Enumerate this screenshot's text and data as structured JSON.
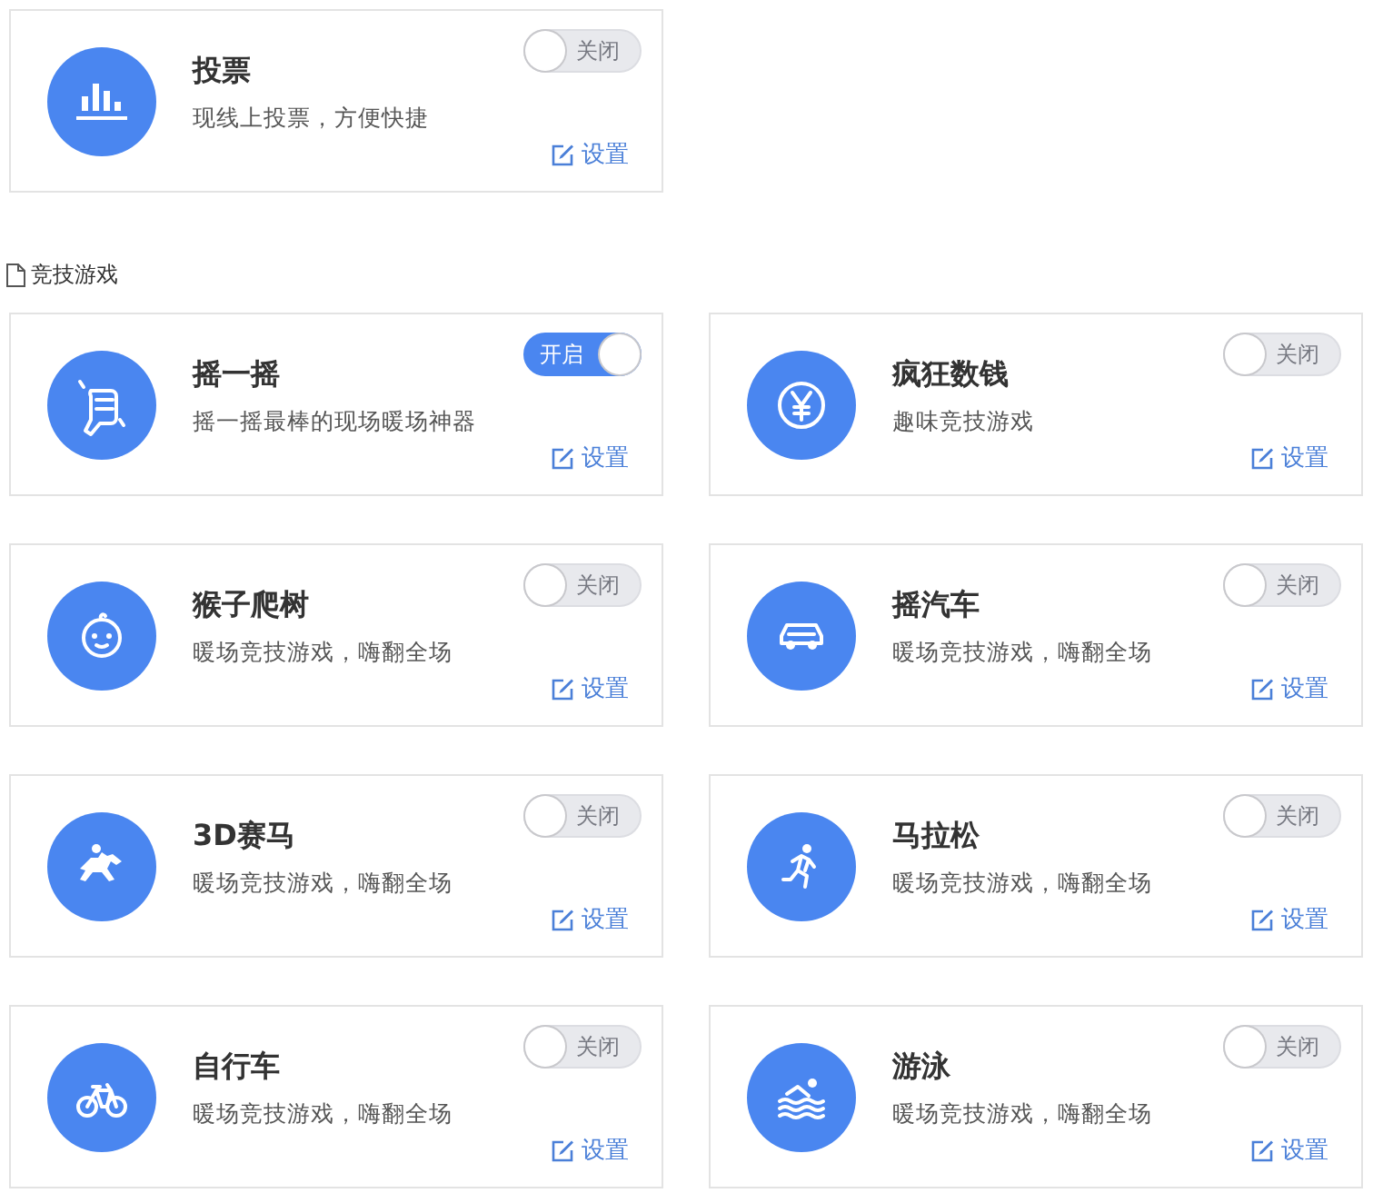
{
  "top_cards": [
    {
      "title": "投票",
      "description": "现线上投票，方便快捷",
      "on": false,
      "toggle_label": "关闭",
      "settings_label": "设置"
    }
  ],
  "section": {
    "title": "竞技游戏"
  },
  "game_cards": [
    {
      "title": "摇一摇",
      "description": "摇一摇最棒的现场暖场神器",
      "on": true,
      "toggle_label": "开启",
      "settings_label": "设置"
    },
    {
      "title": "疯狂数钱",
      "description": "趣味竞技游戏",
      "on": false,
      "toggle_label": "关闭",
      "settings_label": "设置"
    },
    {
      "title": "猴子爬树",
      "description": "暖场竞技游戏，嗨翻全场",
      "on": false,
      "toggle_label": "关闭",
      "settings_label": "设置"
    },
    {
      "title": "摇汽车",
      "description": "暖场竞技游戏，嗨翻全场",
      "on": false,
      "toggle_label": "关闭",
      "settings_label": "设置"
    },
    {
      "title": "3D赛马",
      "description": "暖场竞技游戏，嗨翻全场",
      "on": false,
      "toggle_label": "关闭",
      "settings_label": "设置"
    },
    {
      "title": "马拉松",
      "description": "暖场竞技游戏，嗨翻全场",
      "on": false,
      "toggle_label": "关闭",
      "settings_label": "设置"
    },
    {
      "title": "自行车",
      "description": "暖场竞技游戏，嗨翻全场",
      "on": false,
      "toggle_label": "关闭",
      "settings_label": "设置"
    },
    {
      "title": "游泳",
      "description": "暖场竞技游戏，嗨翻全场",
      "on": false,
      "toggle_label": "关闭",
      "settings_label": "设置"
    }
  ]
}
